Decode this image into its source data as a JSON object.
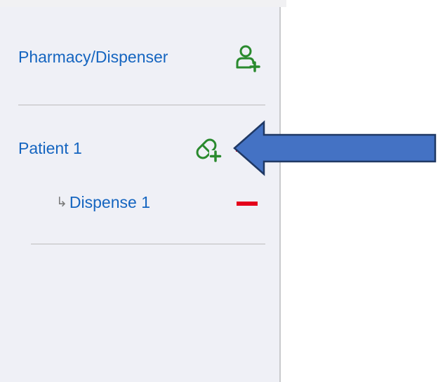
{
  "sidebar": {
    "pharmacy_label": "Pharmacy/Dispenser",
    "add_pharmacy_icon": "person-plus-icon",
    "patient_label": "Patient 1",
    "add_dispense_icon": "pill-plus-icon",
    "remove_icon": "minus-icon",
    "dispense_arrow": "↳",
    "dispense_label": "Dispense 1"
  },
  "annotation": {
    "callout_icon": "blue-arrow-pointing-left"
  },
  "colors": {
    "link_blue": "#1565c0",
    "add_green": "#2a8a2e",
    "remove_red": "#e4001b",
    "arrow_fill": "#4472c4",
    "arrow_stroke": "#1f3864",
    "sidebar_bg": "#eff0f6"
  }
}
